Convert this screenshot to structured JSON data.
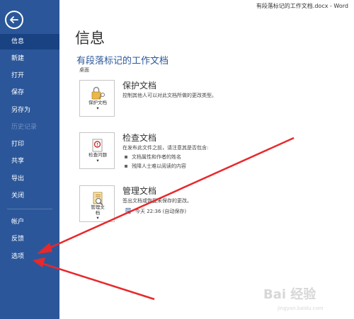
{
  "window": {
    "title": "有段落标记的工作文档.docx - Word"
  },
  "sidebar": {
    "items": [
      {
        "label": "信息",
        "active": true
      },
      {
        "label": "新建"
      },
      {
        "label": "打开"
      },
      {
        "label": "保存"
      },
      {
        "label": "另存为"
      },
      {
        "label": "历史记录",
        "disabled": true
      },
      {
        "label": "打印"
      },
      {
        "label": "共享"
      },
      {
        "label": "导出"
      },
      {
        "label": "关闭"
      },
      {
        "label": "帐户"
      },
      {
        "label": "反馈"
      },
      {
        "label": "选项"
      }
    ]
  },
  "main": {
    "page_title": "信息",
    "doc_title": "有段落标记的工作文档",
    "doc_location": "桌面",
    "protect": {
      "button_label": "保护文档",
      "title": "保护文档",
      "desc": "控制其他人可以对此文档所做的更改类型。"
    },
    "inspect": {
      "button_label": "检查问题",
      "title": "检查文档",
      "desc": "在发布此文件之前，请注意其是否包含:",
      "bullets": [
        "文档属性和作者的姓名",
        "残障人士难以阅读的内容"
      ]
    },
    "manage": {
      "button_label_line1": "管理文",
      "button_label_line2": "档",
      "title": "管理文档",
      "desc": "签出文档或恢复未保存的更改。",
      "version": "今天 22:36 (自动保存)"
    }
  },
  "watermark": {
    "text": "Bai 经验",
    "sub": "jingyan.baidu.com"
  },
  "colors": {
    "sidebar": "#2b579a",
    "sidebar_active": "#194283",
    "accent": "#2b579a",
    "annotation_arrow": "#e8282b"
  }
}
